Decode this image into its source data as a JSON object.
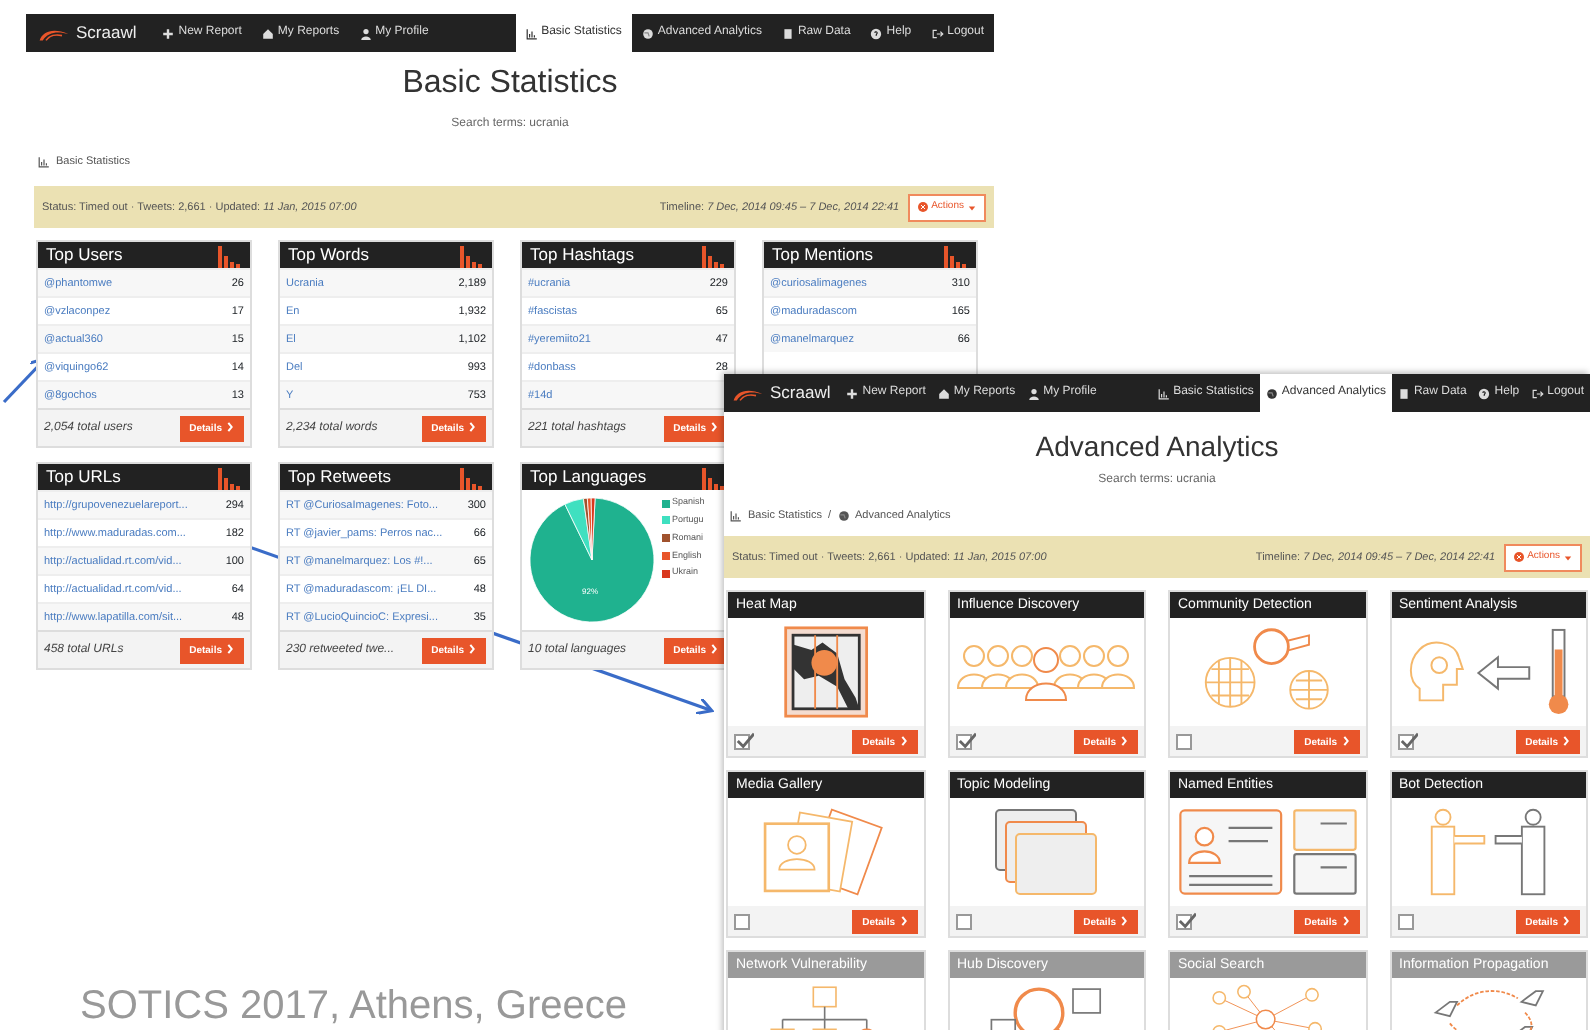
{
  "basic_window": {
    "navbar": {
      "brand": "Scraawl",
      "left_items": [
        {
          "label": "New Report",
          "selected": false
        },
        {
          "label": "My Reports",
          "selected": false
        },
        {
          "label": "My Profile",
          "selected": false
        }
      ],
      "right_items": [
        {
          "label": "Basic Statistics",
          "selected": true
        },
        {
          "label": "Advanced Analytics",
          "selected": false
        },
        {
          "label": "Raw Data",
          "selected": false
        },
        {
          "label": "Help",
          "selected": false
        },
        {
          "label": "Logout",
          "selected": false
        }
      ]
    },
    "title": "Basic Statistics",
    "search_terms": "Search terms: ucrania",
    "breadcrumb": [
      "Basic Statistics"
    ],
    "status": {
      "left": "Status: Timed out · Tweets: 2,661 · Updated: *11 Jan, 2015 07:00*",
      "right": "Timeline: *7 Dec, 2014 09:45 – 7 Dec, 2014 22:41*",
      "actions": "Actions"
    },
    "cards": [
      {
        "kind": "table",
        "title": "Top Users",
        "rows": [
          {
            "label": "@phantomwe",
            "value": "26"
          },
          {
            "label": "@vzlaconpez",
            "value": "17"
          },
          {
            "label": "@actual360",
            "value": "15"
          },
          {
            "label": "@viquingo62",
            "value": "14"
          },
          {
            "label": "@8gochos",
            "value": "13"
          }
        ],
        "total": "2,054 total users",
        "button": "Details"
      },
      {
        "kind": "table",
        "title": "Top Words",
        "rows": [
          {
            "label": "Ucrania",
            "value": "2,189"
          },
          {
            "label": "En",
            "value": "1,932"
          },
          {
            "label": "El",
            "value": "1,102"
          },
          {
            "label": "Del",
            "value": "993"
          },
          {
            "label": "Y",
            "value": "753"
          }
        ],
        "total": "2,234 total words",
        "button": "Details"
      },
      {
        "kind": "table",
        "title": "Top Hashtags",
        "rows": [
          {
            "label": "#ucrania",
            "value": "229"
          },
          {
            "label": "#fascistas",
            "value": "65"
          },
          {
            "label": "#yeremiito21",
            "value": "47"
          },
          {
            "label": "#donbass",
            "value": "28"
          },
          {
            "label": "#14d"
          }
        ],
        "total": "221 total hashtags",
        "button": "Details"
      },
      {
        "kind": "table",
        "title": "Top Mentions",
        "rows": [
          {
            "label": "@curiosalimagenes",
            "value": "310"
          },
          {
            "label": "@maduradascom",
            "value": "165"
          },
          {
            "label": "@manelmarquez",
            "value": "66"
          }
        ]
      },
      {
        "kind": "table",
        "title": "Top URLs",
        "rows": [
          {
            "label": "http://grupovenezuelareport...",
            "value": "294"
          },
          {
            "label": "http://www.maduradas.com...",
            "value": "182"
          },
          {
            "label": "http://actualidad.rt.com/vid...",
            "value": "100"
          },
          {
            "label": "http://actualidad.rt.com/vid...",
            "value": "64"
          },
          {
            "label": "http://www.lapatilla.com/sit...",
            "value": "48"
          }
        ],
        "total": "458 total URLs",
        "button": "Details"
      },
      {
        "kind": "table",
        "title": "Top Retweets",
        "rows": [
          {
            "label": "RT @CuriosaImagenes: Foto...",
            "value": "300"
          },
          {
            "label": "RT @javier_pams: Perros nac...",
            "value": "66"
          },
          {
            "label": "RT @manelmarquez: Los #!...",
            "value": "65"
          },
          {
            "label": "RT @maduradascom: ¡EL DI...",
            "value": "48"
          },
          {
            "label": "RT @LucioQuincioC: Expresi...",
            "value": "35"
          }
        ],
        "total": "230 retweeted twe...",
        "button": "Details"
      },
      {
        "kind": "pie",
        "title": "Top Languages",
        "pie_label": "92%",
        "legend": [
          {
            "label": "Spanish",
            "color": "#1fb28f"
          },
          {
            "label": "Portugu",
            "color": "#3fe0c0"
          },
          {
            "label": "Romani",
            "color": "#a0522d"
          },
          {
            "label": "English",
            "color": "#e8552a"
          },
          {
            "label": "Ukrain",
            "color": "#d9381e"
          }
        ],
        "total": "10 total languages",
        "button": "Details"
      }
    ]
  },
  "advanced_window": {
    "navbar": {
      "brand": "Scraawl",
      "left_items": [
        {
          "label": "New Report",
          "selected": false
        },
        {
          "label": "My Reports",
          "selected": false
        },
        {
          "label": "My Profile",
          "selected": false
        }
      ],
      "right_items": [
        {
          "label": "Basic Statistics",
          "selected": false
        },
        {
          "label": "Advanced Analytics",
          "selected": true
        },
        {
          "label": "Raw Data",
          "selected": false
        },
        {
          "label": "Help",
          "selected": false
        },
        {
          "label": "Logout",
          "selected": false
        }
      ]
    },
    "title": "Advanced Analytics",
    "search_terms": "Search terms: ucrania",
    "breadcrumb": [
      "Basic Statistics",
      "Advanced Analytics"
    ],
    "breadcrumb_separator": "/",
    "status": {
      "left": "Status: Timed out · Tweets: 2,661 · Updated: *11 Jan, 2015 07:00*",
      "right": "Timeline: *7 Dec, 2014 09:45 – 7 Dec, 2014 22:41*",
      "actions": "Actions"
    },
    "modules": [
      {
        "title": "Heat Map",
        "disabled": false,
        "checked": true,
        "button": "Details"
      },
      {
        "title": "Influence Discovery",
        "disabled": false,
        "checked": true,
        "button": "Details"
      },
      {
        "title": "Community Detection",
        "disabled": false,
        "checked": false,
        "button": "Details"
      },
      {
        "title": "Sentiment Analysis",
        "disabled": false,
        "checked": true,
        "button": "Details"
      },
      {
        "title": "Media Gallery",
        "disabled": false,
        "checked": false,
        "button": "Details"
      },
      {
        "title": "Topic Modeling",
        "disabled": false,
        "checked": false,
        "button": "Details"
      },
      {
        "title": "Named Entities",
        "disabled": false,
        "checked": true,
        "button": "Details"
      },
      {
        "title": "Bot Detection",
        "disabled": false,
        "checked": false,
        "button": "Details"
      },
      {
        "title": "Network Vulnerability",
        "disabled": true
      },
      {
        "title": "Hub Discovery",
        "disabled": true
      },
      {
        "title": "Social Search",
        "disabled": true
      },
      {
        "title": "Information Propagation",
        "disabled": true
      }
    ]
  },
  "caption": "SOTICS 2017, Athens, Greece"
}
